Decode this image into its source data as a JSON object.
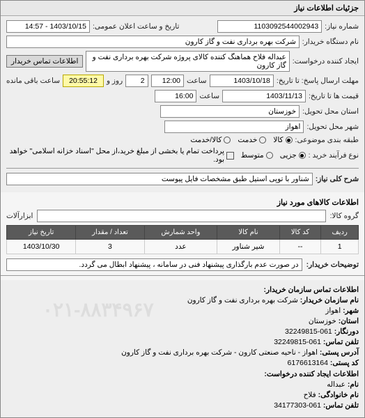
{
  "tab_title": "جزئیات اطلاعات نیاز",
  "form": {
    "need_no_label": "شماره نیاز:",
    "need_no": "1103092544002943",
    "announce_label": "تاریخ و ساعت اعلان عمومی:",
    "announce_value": "1403/10/15 - 14:57",
    "buyer_label": "نام دستگاه خریدار:",
    "buyer_value": "شرکت بهره برداری نفت و گاز کارون",
    "creator_label": "ایجاد کننده درخواست:",
    "creator_value": "عبداله فلاح هماهنگ کننده کالای پروژه شرکت بهره برداری نفت و گاز کارون",
    "contact_btn": "اطلاعات تماس خریدار",
    "deadline_send_label": "مهلت ارسال پاسخ: تا تاریخ:",
    "deadline_send_date": "1403/10/18",
    "time_label": "ساعت",
    "deadline_send_time": "12:00",
    "day_count": "2",
    "day_label": "روز و",
    "remaining": "20:55:12",
    "remaining_label": "ساعت باقی مانده",
    "price_until_label": "قیمت ها تا تاریخ:",
    "price_until_date": "1403/11/13",
    "price_until_time": "16:00",
    "province_label": "استان محل تحویل:",
    "province_value": "خوزستان",
    "city_label": "شهر محل تحویل:",
    "city_value": "اهواز",
    "category_label": "طبقه بندی موضوعی:",
    "cat_goods": "کالا",
    "cat_service": "خدمت",
    "cat_both": "کالا/خدمت",
    "purchase_type_label": "نوع فرآیند خرید :",
    "pt_partial": "جزیی",
    "pt_medium": "متوسط",
    "pt_full_desc": "پرداخت تمام یا بخشی از مبلغ خرید،از محل \"اسناد خزانه اسلامی\" خواهد بود.",
    "need_desc_label": "شرح کلی نیاز:",
    "need_desc_value": "شناور با توپی استیل طبق مشخصات فایل پیوست"
  },
  "items_title": "اطلاعات کالاهای مورد نیاز",
  "group_label": "گروه کالا:",
  "group_value": "ابزارآلات",
  "table": {
    "headers": [
      "ردیف",
      "کد کالا",
      "نام کالا",
      "واحد شمارش",
      "تعداد / مقدار",
      "تاریخ نیاز"
    ],
    "row": [
      "1",
      "--",
      "شیر شناور",
      "عدد",
      "3",
      "1403/10/30"
    ]
  },
  "buyer_note_label": "توضیحات خریدار:",
  "buyer_note_value": "در صورت عدم بارگذاری پیشنهاد فنی در سامانه ، پیشنهاد ابطال می گردد.",
  "contact_title": "اطلاعات تماس سازمان خریدار:",
  "contact": {
    "org_label": "نام سازمان خریدار:",
    "org_value": "شرکت بهره برداری نفت و گاز کارون",
    "city_label": "شهر:",
    "city_value": "اهواز",
    "prov_label": "استان:",
    "prov_value": "خوزستان",
    "fax_label": "دورنگار:",
    "fax_value": "061-32249815",
    "tel_label": "تلفن تماس:",
    "tel_value": "061-32249815",
    "addr_label": "آدرس پستی:",
    "addr_value": "اهواز - ناحیه صنعتی کارون - شرکت بهره برداری نفت و گاز کارون",
    "post_label": "کد پستی:",
    "post_value": "6176613164",
    "req_creator_title": "اطلاعات ایجاد کننده درخواست:",
    "name_label": "نام:",
    "name_value": "عبداله",
    "lname_label": "نام خانوادگی:",
    "lname_value": "فلاح",
    "ctel_label": "تلفن تماس:",
    "ctel_value": "061-34177303",
    "watermark": "۰۲۱-۸۸۳۴۹۶۷"
  }
}
